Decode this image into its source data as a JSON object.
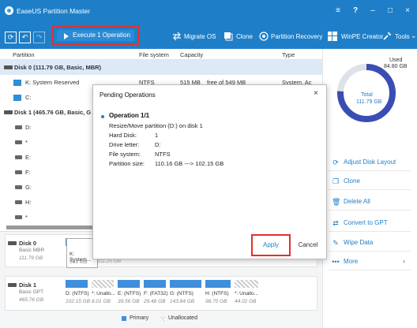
{
  "window": {
    "title": "EaseUS Partition Master"
  },
  "window_controls": {
    "menu": "≡",
    "help": "?",
    "min": "–",
    "max": "□",
    "close": "×"
  },
  "toolbar": {
    "execute": "Execute 1 Operation",
    "migrate": "Migrate OS",
    "clone": "Clone",
    "recovery": "Partition Recovery",
    "winpe": "WinPE Creator",
    "tools": "Tools"
  },
  "table": {
    "headers": {
      "partition": "Partition",
      "fs": "File system",
      "capacity": "Capacity",
      "type": "Type"
    },
    "rows": [
      {
        "name": "Disk 0 (111.79 GB, Basic, MBR)"
      },
      {
        "name": "K: System Reserved",
        "fs": "NTFS",
        "cap": "515 MB",
        "free": "free of 549 MB",
        "type": "System, Ac"
      },
      {
        "name": "C:"
      },
      {
        "name": "Disk 1 (465.76 GB, Basic, G"
      },
      {
        "name": "D:"
      },
      {
        "name": "*"
      },
      {
        "name": "E:"
      },
      {
        "name": "F:"
      },
      {
        "name": "G:"
      },
      {
        "name": "H:"
      },
      {
        "name": "*"
      }
    ]
  },
  "chart_data": {
    "type": "pie",
    "title": "Total",
    "total_label": "111.79 GB",
    "used_label": "Used",
    "used_value": "84.80 GB",
    "used_fraction": 0.76
  },
  "actions": [
    "Adjust Disk Layout",
    "Clone",
    "Delete All",
    "Convert to GPT",
    "Wipe Data",
    "More"
  ],
  "dialog": {
    "title": "Pending Operations",
    "close": "×",
    "op": "Operation 1/1",
    "desc": "Resize/Move partition (D:) on disk 1",
    "hd_label": "Hard Disk:",
    "hd_value": "1",
    "dl_label": "Drive letter:",
    "dl_value": "D:",
    "fs_label": "File system:",
    "fs_value": "NTFS",
    "ps_label": "Partition size:",
    "ps_value": "110.16 GB ---> 102.15 GB",
    "apply": "Apply",
    "cancel": "Cancel"
  },
  "disk0": {
    "name": "Disk 0",
    "type": "Basic MBR",
    "size": "111.79 GB",
    "k_label": "K: System...",
    "k_size": "549 MB",
    "c_size": "111.25 GB"
  },
  "disk1": {
    "name": "Disk 1",
    "type": "Basic GPT",
    "size": "465.76 GB",
    "segs": [
      {
        "label": "D: (NTFS)",
        "size": "102.15 GB"
      },
      {
        "label": "*: Unallo...",
        "size": "8.01 GB"
      },
      {
        "label": "E: (NTFS)",
        "size": "39.56 GB"
      },
      {
        "label": "F: (FAT32)",
        "size": "29.48 GB"
      },
      {
        "label": "G: (NTFS)",
        "size": "143.84 GB"
      },
      {
        "label": "H: (NTFS)",
        "size": "98.70 GB"
      },
      {
        "label": "*: Unallo...",
        "size": "44.02 GB"
      }
    ]
  },
  "legend": {
    "primary": "Primary",
    "unallocated": "Unallocated"
  },
  "colors": {
    "brand": "#1e7fc8",
    "primary": "#3f8fdc",
    "highlight": "#e0312b"
  }
}
